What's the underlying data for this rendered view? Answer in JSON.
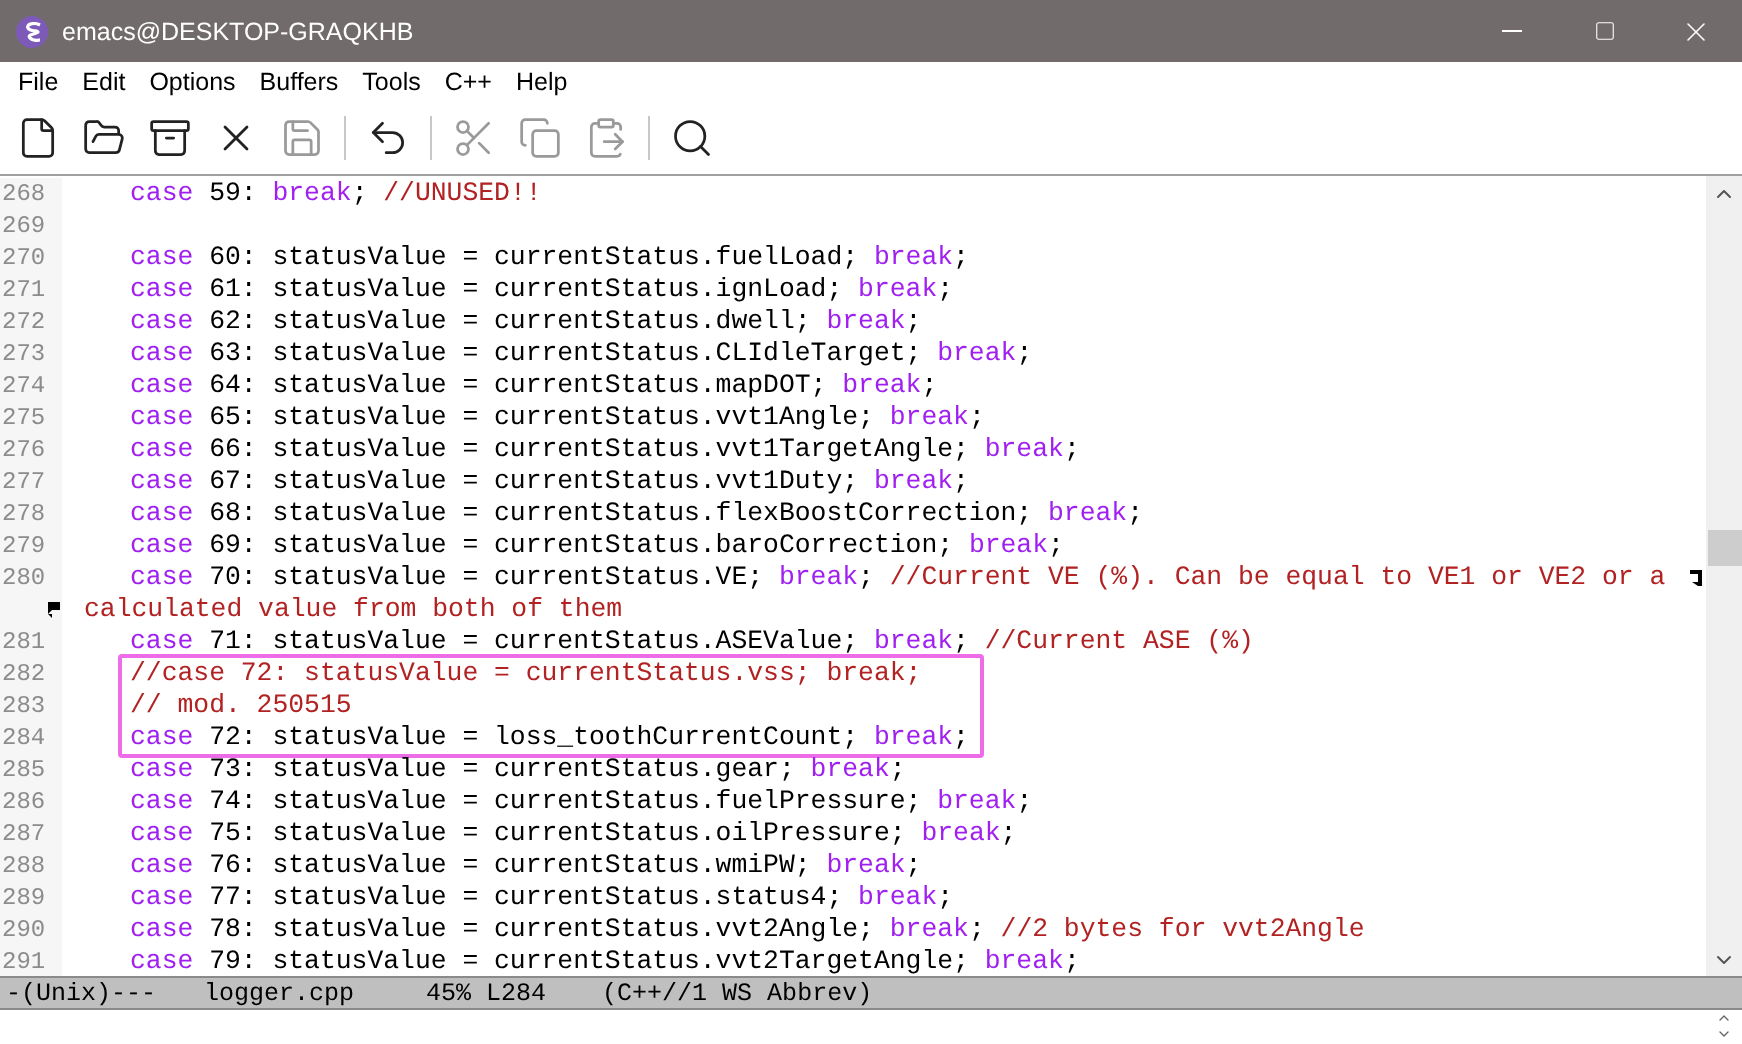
{
  "window": {
    "title": "emacs@DESKTOP-GRAQKHB"
  },
  "menu": [
    "File",
    "Edit",
    "Options",
    "Buffers",
    "Tools",
    "C++",
    "Help"
  ],
  "toolbar": [
    {
      "kind": "new",
      "disabled": false
    },
    {
      "kind": "open",
      "disabled": false
    },
    {
      "kind": "dired",
      "disabled": false
    },
    {
      "kind": "close",
      "disabled": false
    },
    {
      "kind": "save",
      "disabled": true
    },
    {
      "kind": "separator"
    },
    {
      "kind": "undo",
      "disabled": false
    },
    {
      "kind": "separator"
    },
    {
      "kind": "cut",
      "disabled": true
    },
    {
      "kind": "copy",
      "disabled": true
    },
    {
      "kind": "paste",
      "disabled": true
    },
    {
      "kind": "separator"
    },
    {
      "kind": "search",
      "disabled": false
    }
  ],
  "lines": [
    {
      "kind": "code",
      "number": "268",
      "segments": [
        {
          "kind": "keyword",
          "text": "case"
        },
        {
          "kind": "plain",
          "text": " 59: "
        },
        {
          "kind": "keyword",
          "text": "break"
        },
        {
          "kind": "plain",
          "text": "; "
        },
        {
          "kind": "comment",
          "text": "//UNUSED!!"
        }
      ]
    },
    {
      "kind": "code",
      "number": "269"
    },
    {
      "kind": "code",
      "number": "270",
      "segments": [
        {
          "kind": "keyword",
          "text": "case"
        },
        {
          "kind": "plain",
          "text": " 60: statusValue = currentStatus.fuelLoad; "
        },
        {
          "kind": "keyword",
          "text": "break"
        },
        {
          "kind": "plain",
          "text": ";"
        }
      ]
    },
    {
      "kind": "code",
      "number": "271",
      "segments": [
        {
          "kind": "keyword",
          "text": "case"
        },
        {
          "kind": "plain",
          "text": " 61: statusValue = currentStatus.ignLoad; "
        },
        {
          "kind": "keyword",
          "text": "break"
        },
        {
          "kind": "plain",
          "text": ";"
        }
      ]
    },
    {
      "kind": "code",
      "number": "272",
      "segments": [
        {
          "kind": "keyword",
          "text": "case"
        },
        {
          "kind": "plain",
          "text": " 62: statusValue = currentStatus.dwell; "
        },
        {
          "kind": "keyword",
          "text": "break"
        },
        {
          "kind": "plain",
          "text": ";"
        }
      ]
    },
    {
      "kind": "code",
      "number": "273",
      "segments": [
        {
          "kind": "keyword",
          "text": "case"
        },
        {
          "kind": "plain",
          "text": " 63: statusValue = currentStatus.CLIdleTarget; "
        },
        {
          "kind": "keyword",
          "text": "break"
        },
        {
          "kind": "plain",
          "text": ";"
        }
      ]
    },
    {
      "kind": "code",
      "number": "274",
      "segments": [
        {
          "kind": "keyword",
          "text": "case"
        },
        {
          "kind": "plain",
          "text": " 64: statusValue = currentStatus.mapDOT; "
        },
        {
          "kind": "keyword",
          "text": "break"
        },
        {
          "kind": "plain",
          "text": ";"
        }
      ]
    },
    {
      "kind": "code",
      "number": "275",
      "segments": [
        {
          "kind": "keyword",
          "text": "case"
        },
        {
          "kind": "plain",
          "text": " 65: statusValue = currentStatus.vvt1Angle; "
        },
        {
          "kind": "keyword",
          "text": "break"
        },
        {
          "kind": "plain",
          "text": ";"
        }
      ]
    },
    {
      "kind": "code",
      "number": "276",
      "segments": [
        {
          "kind": "keyword",
          "text": "case"
        },
        {
          "kind": "plain",
          "text": " 66: statusValue = currentStatus.vvt1TargetAngle; "
        },
        {
          "kind": "keyword",
          "text": "break"
        },
        {
          "kind": "plain",
          "text": ";"
        }
      ]
    },
    {
      "kind": "code",
      "number": "277",
      "segments": [
        {
          "kind": "keyword",
          "text": "case"
        },
        {
          "kind": "plain",
          "text": " 67: statusValue = currentStatus.vvt1Duty; "
        },
        {
          "kind": "keyword",
          "text": "break"
        },
        {
          "kind": "plain",
          "text": ";"
        }
      ]
    },
    {
      "kind": "code",
      "number": "278",
      "segments": [
        {
          "kind": "keyword",
          "text": "case"
        },
        {
          "kind": "plain",
          "text": " 68: statusValue = currentStatus.flexBoostCorrection; "
        },
        {
          "kind": "keyword",
          "text": "break"
        },
        {
          "kind": "plain",
          "text": ";"
        }
      ]
    },
    {
      "kind": "code",
      "number": "279",
      "segments": [
        {
          "kind": "keyword",
          "text": "case"
        },
        {
          "kind": "plain",
          "text": " 69: statusValue = currentStatus.baroCorrection; "
        },
        {
          "kind": "keyword",
          "text": "break"
        },
        {
          "kind": "plain",
          "text": ";"
        }
      ]
    },
    {
      "kind": "code",
      "number": "280",
      "wrapped": true,
      "segments": [
        {
          "kind": "keyword",
          "text": "case"
        },
        {
          "kind": "plain",
          "text": " 70: statusValue = currentStatus.VE; "
        },
        {
          "kind": "keyword",
          "text": "break"
        },
        {
          "kind": "plain",
          "text": "; "
        },
        {
          "kind": "comment",
          "text": "//Current VE (%). Can be equal to VE1 or VE2 or a"
        }
      ]
    },
    {
      "kind": "continuation",
      "segments": [
        {
          "kind": "comment",
          "text": "calculated value from both of them"
        }
      ]
    },
    {
      "kind": "code",
      "number": "281",
      "segments": [
        {
          "kind": "keyword",
          "text": "case"
        },
        {
          "kind": "plain",
          "text": " 71: statusValue = currentStatus.ASEValue; "
        },
        {
          "kind": "keyword",
          "text": "break"
        },
        {
          "kind": "plain",
          "text": "; "
        },
        {
          "kind": "comment",
          "text": "//Current ASE (%)"
        }
      ]
    },
    {
      "kind": "code",
      "number": "282",
      "highlighted": true,
      "segments": [
        {
          "kind": "comment",
          "text": "//case 72: statusValue = currentStatus.vss; break;"
        }
      ]
    },
    {
      "kind": "code",
      "number": "283",
      "highlighted": true,
      "segments": [
        {
          "kind": "comment",
          "text": "// mod. 250515"
        }
      ]
    },
    {
      "kind": "code",
      "number": "284",
      "highlighted": true,
      "segments": [
        {
          "kind": "keyword",
          "text": "case"
        },
        {
          "kind": "plain",
          "text": " 72: statusValue = loss_toothCurrentCount; "
        },
        {
          "kind": "keyword",
          "text": "break"
        },
        {
          "kind": "plain",
          "text": ";"
        }
      ]
    },
    {
      "kind": "code",
      "number": "285",
      "segments": [
        {
          "kind": "keyword",
          "text": "case"
        },
        {
          "kind": "plain",
          "text": " 73: statusValue = currentStatus.gear; "
        },
        {
          "kind": "keyword",
          "text": "break"
        },
        {
          "kind": "plain",
          "text": ";"
        }
      ]
    },
    {
      "kind": "code",
      "number": "286",
      "segments": [
        {
          "kind": "keyword",
          "text": "case"
        },
        {
          "kind": "plain",
          "text": " 74: statusValue = currentStatus.fuelPressure; "
        },
        {
          "kind": "keyword",
          "text": "break"
        },
        {
          "kind": "plain",
          "text": ";"
        }
      ]
    },
    {
      "kind": "code",
      "number": "287",
      "segments": [
        {
          "kind": "keyword",
          "text": "case"
        },
        {
          "kind": "plain",
          "text": " 75: statusValue = currentStatus.oilPressure; "
        },
        {
          "kind": "keyword",
          "text": "break"
        },
        {
          "kind": "plain",
          "text": ";"
        }
      ]
    },
    {
      "kind": "code",
      "number": "288",
      "segments": [
        {
          "kind": "keyword",
          "text": "case"
        },
        {
          "kind": "plain",
          "text": " 76: statusValue = currentStatus.wmiPW; "
        },
        {
          "kind": "keyword",
          "text": "break"
        },
        {
          "kind": "plain",
          "text": ";"
        }
      ]
    },
    {
      "kind": "code",
      "number": "289",
      "segments": [
        {
          "kind": "keyword",
          "text": "case"
        },
        {
          "kind": "plain",
          "text": " 77: statusValue = currentStatus.status4; "
        },
        {
          "kind": "keyword",
          "text": "break"
        },
        {
          "kind": "plain",
          "text": ";"
        }
      ]
    },
    {
      "kind": "code",
      "number": "290",
      "segments": [
        {
          "kind": "keyword",
          "text": "case"
        },
        {
          "kind": "plain",
          "text": " 78: statusValue = currentStatus.vvt2Angle; "
        },
        {
          "kind": "keyword",
          "text": "break"
        },
        {
          "kind": "plain",
          "text": "; "
        },
        {
          "kind": "comment",
          "text": "//2 bytes for vvt2Angle"
        }
      ]
    },
    {
      "kind": "code",
      "number": "291",
      "segments": [
        {
          "kind": "keyword",
          "text": "case"
        },
        {
          "kind": "plain",
          "text": " 79: statusValue = currentStatus.vvt2TargetAngle; "
        },
        {
          "kind": "keyword",
          "text": "break"
        },
        {
          "kind": "plain",
          "text": ";"
        }
      ]
    }
  ],
  "mode_line": {
    "state": "-(Unix)---",
    "buffer": "logger.cpp",
    "position": "45% L284",
    "modes": "(C++//1 WS Abbrev)"
  }
}
